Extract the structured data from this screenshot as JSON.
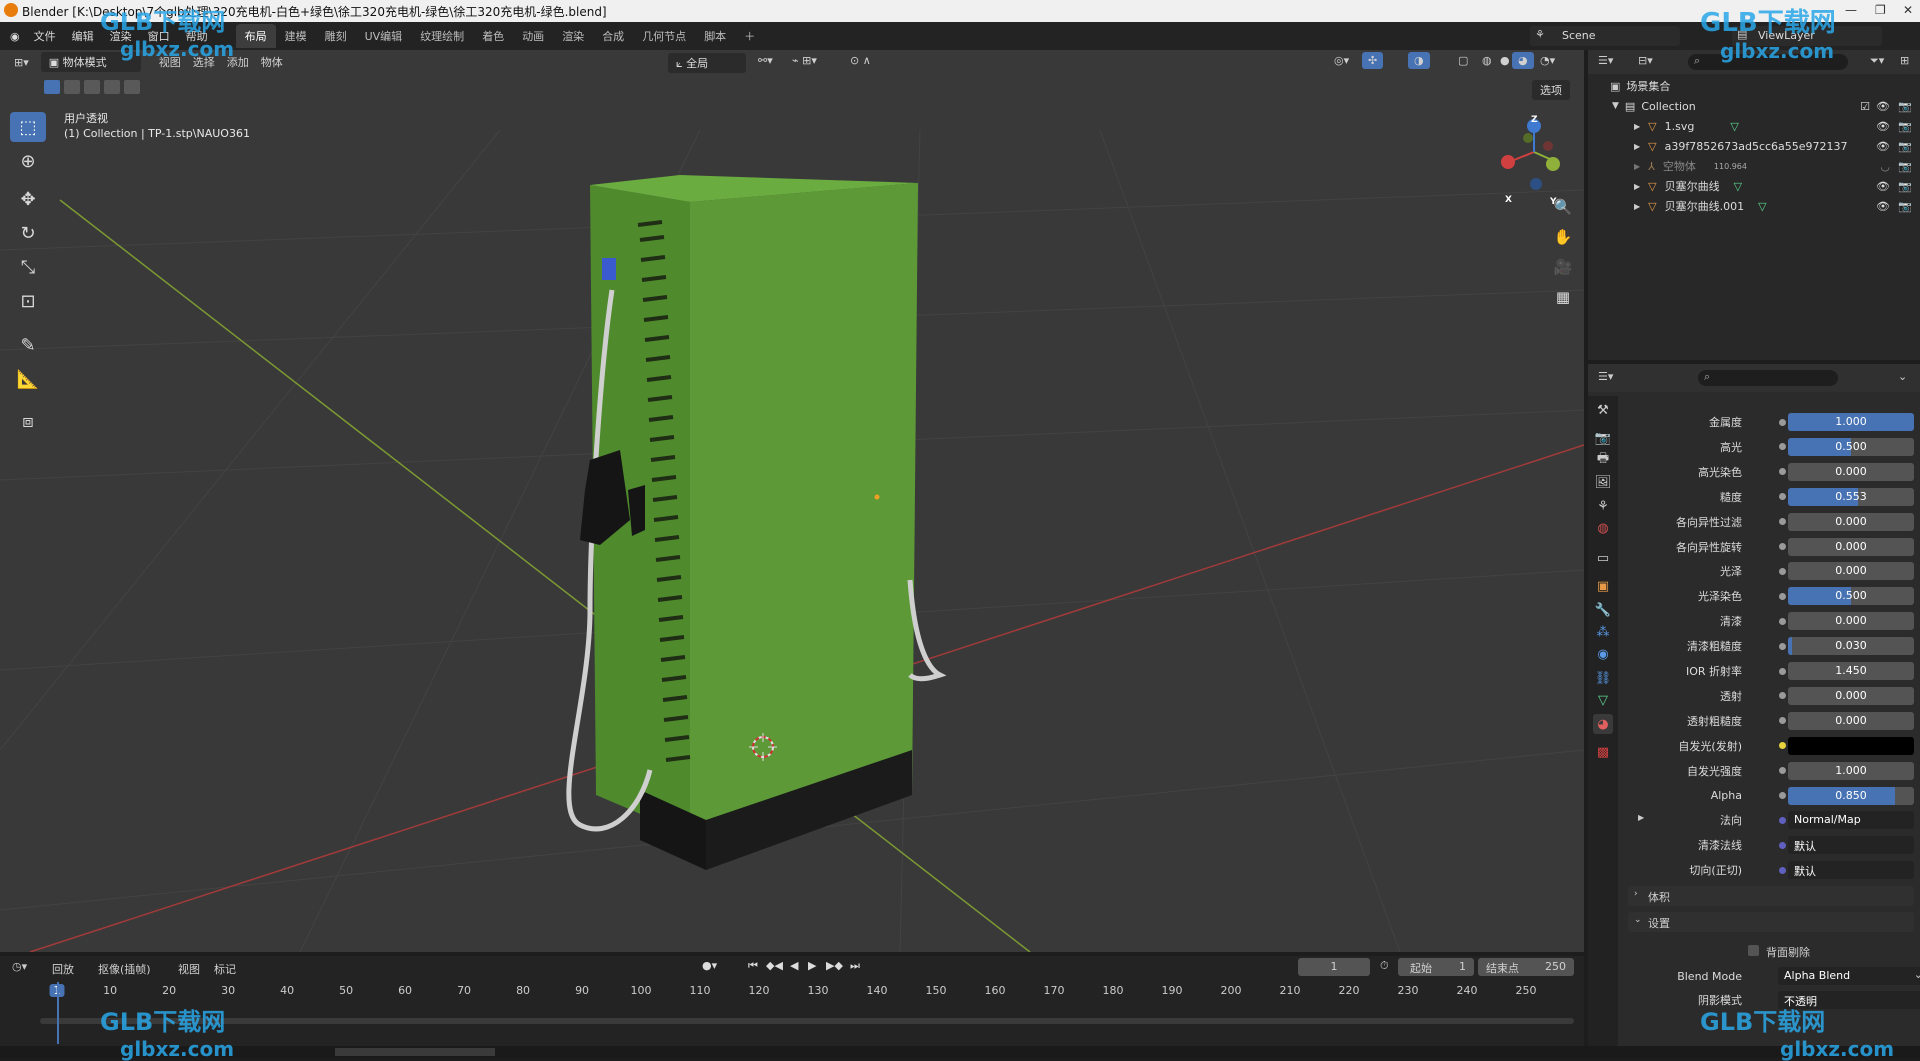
{
  "window": {
    "title": "Blender [K:\\Desktop\\7个glb处理\\320充电机-白色+绿色\\徐工320充电机-绿色\\徐工320充电机-绿色.blend]"
  },
  "menu": [
    "文件",
    "编辑",
    "渲染",
    "窗口",
    "帮助"
  ],
  "workspaces": [
    "布局",
    "建模",
    "雕刻",
    "UV编辑",
    "纹理绘制",
    "着色",
    "动画",
    "渲染",
    "合成",
    "几何节点",
    "脚本"
  ],
  "active_workspace": "布局",
  "scene_label": "Scene",
  "view_layer": "ViewLayer",
  "viewport": {
    "mode": "物体模式",
    "menus": [
      "视图",
      "选择",
      "添加",
      "物体"
    ],
    "orientation": "全局",
    "options": "选项",
    "view_name": "用户透视",
    "collection_info": "(1) Collection | TP-1.stp\\NAUO361",
    "gizmo": {
      "x": "X",
      "y": "Y",
      "z": "Z"
    }
  },
  "outliner": {
    "root": "场景集合",
    "collection": "Collection",
    "items": [
      {
        "name": "1.svg"
      },
      {
        "name": "a39f7852673ad5cc6a55e972137"
      },
      {
        "name": "空物体",
        "badge": "110.964"
      },
      {
        "name": "贝塞尔曲线"
      },
      {
        "name": "贝塞尔曲线.001"
      }
    ]
  },
  "properties": {
    "rows": [
      {
        "label": "金属度",
        "value": "1.000",
        "fill": 1.0
      },
      {
        "label": "高光",
        "value": "0.500",
        "fill": 0.5
      },
      {
        "label": "高光染色",
        "value": "0.000",
        "fill": 0
      },
      {
        "label": "糙度",
        "value": "0.553",
        "fill": 0.553
      },
      {
        "label": "各向异性过滤",
        "value": "0.000",
        "fill": 0
      },
      {
        "label": "各向异性旋转",
        "value": "0.000",
        "fill": 0
      },
      {
        "label": "光泽",
        "value": "0.000",
        "fill": 0
      },
      {
        "label": "光泽染色",
        "value": "0.500",
        "fill": 0.5
      },
      {
        "label": "清漆",
        "value": "0.000",
        "fill": 0
      },
      {
        "label": "清漆粗糙度",
        "value": "0.030",
        "fill": 0.03
      },
      {
        "label": "IOR 折射率",
        "value": "1.450",
        "fill": 0
      },
      {
        "label": "透射",
        "value": "0.000",
        "fill": 0
      },
      {
        "label": "透射粗糙度",
        "value": "0.000",
        "fill": 0
      },
      {
        "label": "自发光(发射)",
        "value": "",
        "fill": 0,
        "color": "#000000"
      },
      {
        "label": "自发光强度",
        "value": "1.000",
        "fill": 0
      },
      {
        "label": "Alpha",
        "value": "0.850",
        "fill": 0.85
      },
      {
        "label": "法向",
        "value": "Normal/Map",
        "fill": 0
      },
      {
        "label": "清漆法线",
        "value": "默认",
        "fill": 0
      },
      {
        "label": "切向(正切)",
        "value": "默认",
        "fill": 0
      }
    ],
    "panel_volume": "体积",
    "panel_settings": "设置",
    "backface": "背面剔除",
    "blend_mode_label": "Blend Mode",
    "blend_mode_value": "Alpha Blend",
    "shadow_mode_label": "阴影模式",
    "shadow_mode_value": "不透明"
  },
  "timeline": {
    "menus": [
      "回放",
      "抠像(插帧)",
      "视图",
      "标记"
    ],
    "current_frame": "1",
    "start_label": "起始",
    "start_value": "1",
    "end_label": "结束点",
    "end_value": "250",
    "ticks": [
      "1",
      "10",
      "20",
      "30",
      "40",
      "50",
      "60",
      "70",
      "80",
      "90",
      "100",
      "110",
      "120",
      "130",
      "140",
      "150",
      "160",
      "170",
      "180",
      "190",
      "200",
      "210",
      "220",
      "230",
      "240",
      "250"
    ]
  },
  "watermark": {
    "brand": "GLB下载网",
    "url": "glbxz.com"
  },
  "colors": {
    "accent": "#4772b3",
    "cabinet_green": "#5d9a37",
    "axis_x": "#c0392b",
    "axis_y": "#8fb03a"
  }
}
